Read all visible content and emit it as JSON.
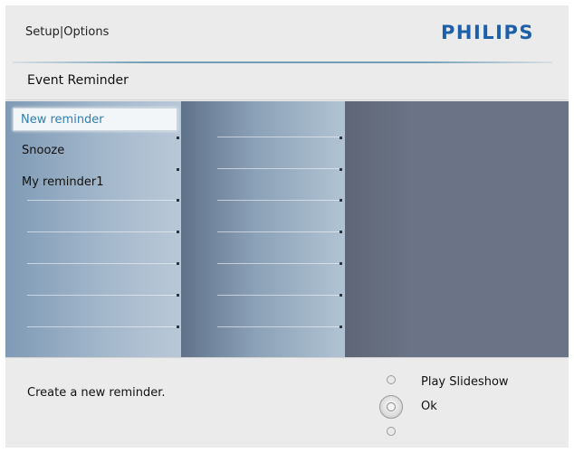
{
  "header": {
    "breadcrumb": "Setup|Options",
    "brand": "PHILIPS"
  },
  "page_title": "Event Reminder",
  "menu": {
    "items": [
      {
        "label": "New reminder",
        "selected": true
      },
      {
        "label": "Snooze",
        "selected": false
      },
      {
        "label": "My reminder1",
        "selected": false
      }
    ]
  },
  "footer": {
    "help_text": "Create  a new reminder.",
    "controls": {
      "up_label": "Play Slideshow",
      "ok_label": "Ok"
    }
  },
  "colors": {
    "brand": "#1d5fa8",
    "selected_text": "#2f7fb0",
    "panel_dark": "#6a7384"
  },
  "icons": [
    "nav-up-icon",
    "ok-button-icon",
    "nav-down-icon"
  ]
}
